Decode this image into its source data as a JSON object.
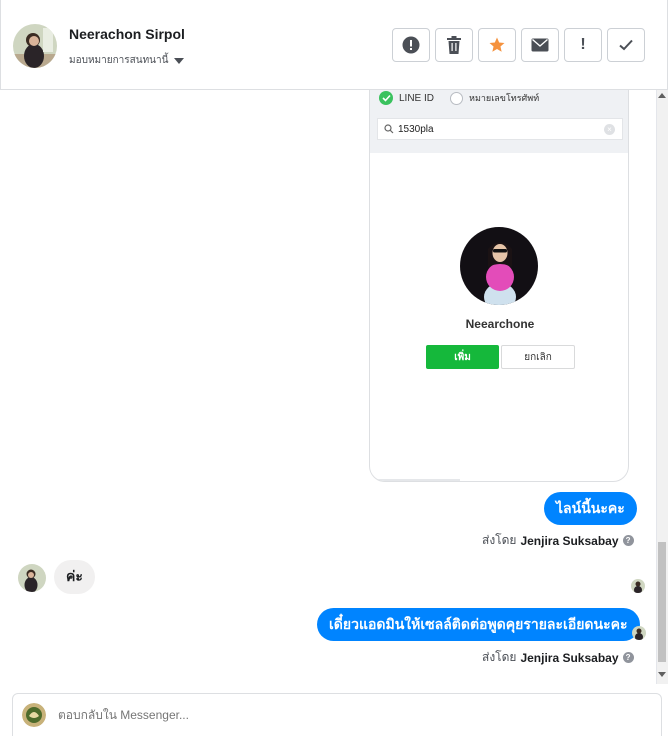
{
  "header": {
    "contact_name": "Neerachon Sirpol",
    "assign_label": "มอบหมายการสนทนานี้",
    "tools": [
      {
        "name": "spam",
        "label": "!"
      },
      {
        "name": "delete",
        "label": ""
      },
      {
        "name": "star",
        "label": ""
      },
      {
        "name": "mark-unread",
        "label": ""
      },
      {
        "name": "follow-up",
        "label": "!"
      },
      {
        "name": "done",
        "label": ""
      }
    ]
  },
  "attachment": {
    "radio_line_id": "LINE ID",
    "radio_phone": "หมายเลขโทรศัพท์",
    "search_value": "1530pla",
    "profile_name": "Neearchone⁠  ",
    "profile_name_display": "Neearchone",
    "add_button": "เพิ่ม",
    "cancel_button": "ยกเลิก"
  },
  "messages": [
    {
      "direction": "out",
      "text": "ไลน์นี้นะคะ"
    },
    {
      "direction": "in",
      "text": "ค่ะ"
    },
    {
      "direction": "out",
      "text": "เดี๋ยวแอดมินให้เซลล์ติดต่อพูดคุยรายละเอียดนะคะ"
    }
  ],
  "sent_by": {
    "prefix": "ส่งโดย",
    "agent": "Jenjira Suksabay",
    "help": "?"
  },
  "composer": {
    "placeholder": "ตอบกลับใน Messenger..."
  },
  "colors": {
    "brand_blue": "#0084ff",
    "line_green": "#15b83b",
    "star_orange": "#f5923e"
  }
}
